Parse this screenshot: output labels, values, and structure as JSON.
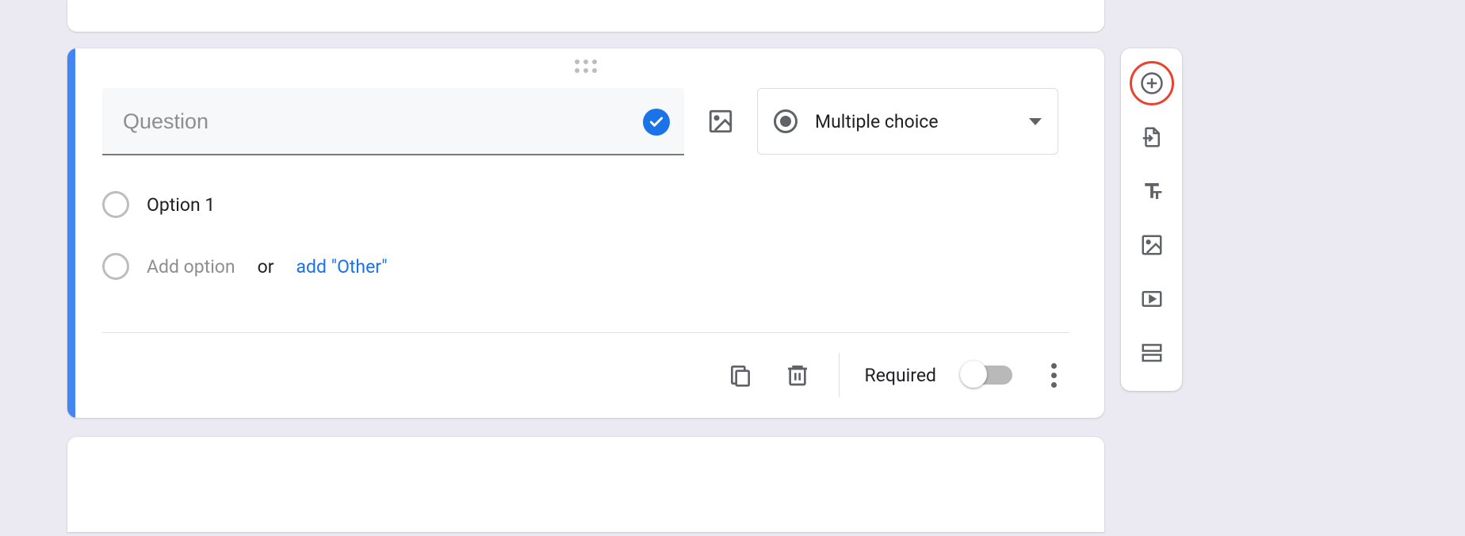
{
  "question": {
    "placeholder": "Question",
    "value": "",
    "type_label": "Multiple choice",
    "options": [
      "Option 1"
    ],
    "add_option_text": "Add option",
    "or_text": "or",
    "add_other_text": "add \"Other\""
  },
  "footer": {
    "required_label": "Required",
    "required": false
  },
  "colors": {
    "accent": "#4285f4",
    "highlight": "#e8432e"
  }
}
